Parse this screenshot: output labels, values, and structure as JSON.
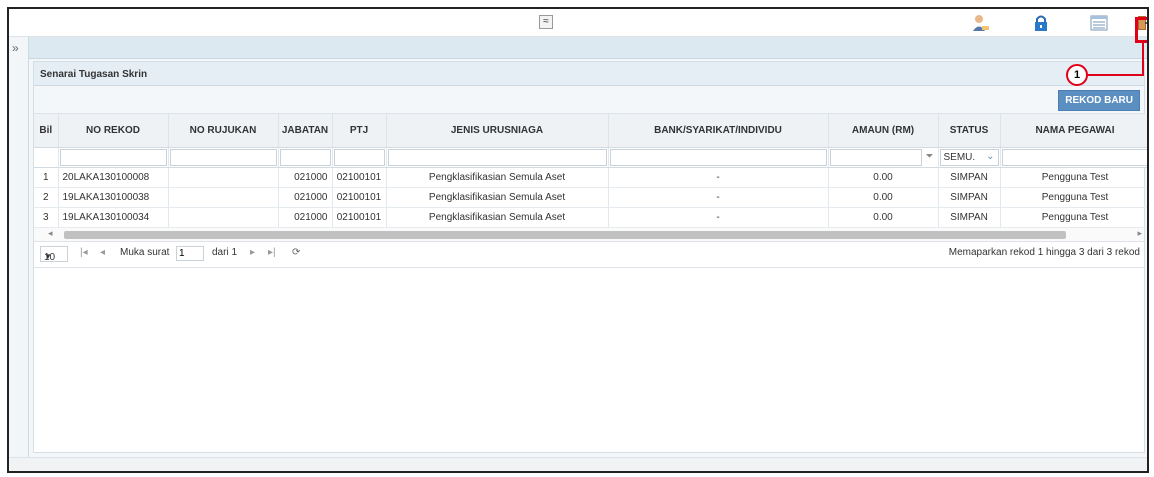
{
  "topbar": {
    "collapse_glyph": "≈",
    "icons": [
      "user-profile-icon",
      "lock-icon",
      "list-view-icon",
      "logout-icon"
    ]
  },
  "sidebar": {
    "expand_glyph": "»"
  },
  "panel": {
    "title": "Senarai Tugasan Skrin"
  },
  "toolbar": {
    "rekod_baru": "REKOD BARU"
  },
  "table": {
    "headers": {
      "bil": "Bil",
      "no_rekod": "NO REKOD",
      "no_rujukan": "NO RUJUKAN",
      "jabatan": "JABATAN",
      "ptj": "PTJ",
      "jenis": "JENIS URUSNIAGA",
      "bank": "BANK/SYARIKAT/INDIVIDU",
      "amaun": "AMAUN (RM)",
      "status": "STATUS",
      "nama": "NAMA PEGAWAI"
    },
    "filter": {
      "status_value": "SEMU."
    },
    "rows": [
      {
        "bil": "1",
        "no_rekod": "20LAKA130100008",
        "no_rujukan": "",
        "jabatan": "021000",
        "ptj": "02100101",
        "jenis": "Pengklasifikasian Semula Aset",
        "bank": "-",
        "amaun": "0.00",
        "status": "SIMPAN",
        "nama": "Pengguna Test"
      },
      {
        "bil": "2",
        "no_rekod": "19LAKA130100038",
        "no_rujukan": "",
        "jabatan": "021000",
        "ptj": "02100101",
        "jenis": "Pengklasifikasian Semula Aset",
        "bank": "-",
        "amaun": "0.00",
        "status": "SIMPAN",
        "nama": "Pengguna Test"
      },
      {
        "bil": "3",
        "no_rekod": "19LAKA130100034",
        "no_rujukan": "",
        "jabatan": "021000",
        "ptj": "02100101",
        "jenis": "Pengklasifikasian Semula Aset",
        "bank": "-",
        "amaun": "0.00",
        "status": "SIMPAN",
        "nama": "Pengguna Test"
      }
    ]
  },
  "pager": {
    "page_size": "10",
    "page_label": "Muka surat",
    "page_value": "1",
    "of_label": "dari 1",
    "summary": "Memaparkan rekod 1 hingga 3 dari 3 rekod"
  },
  "callout": {
    "number": "1"
  },
  "colors": {
    "callout": "#e0001a",
    "button": "#5b8ec1",
    "header_bg": "#e5eef4"
  }
}
